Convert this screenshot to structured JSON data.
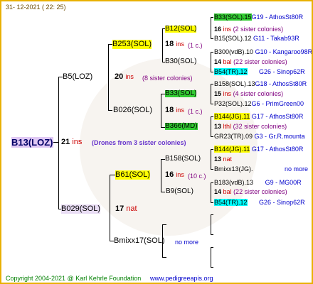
{
  "header": {
    "date": "31- 12-2021 ( 22: 25)"
  },
  "root": {
    "label": "B13(LOZ)",
    "count": "21",
    "count_suffix": "ins",
    "note": "(Drones from 3 sister colonies)"
  },
  "g1": [
    {
      "label": "B5(LOZ)",
      "count": "20",
      "count_suffix": "ins",
      "note": "(8 sister colonies)"
    },
    {
      "label": "B029(SOL)",
      "count": "17",
      "count_suffix": "nat"
    }
  ],
  "g2": [
    {
      "label": "B253(SOL)",
      "count": "18",
      "count_suffix": "ins",
      "note": "(1 c.)"
    },
    {
      "label": "B026(SOL)",
      "count": "18",
      "count_suffix": "ins",
      "note": "(1 c.)"
    },
    {
      "label": "B61(SOL)",
      "count": "16",
      "count_suffix": "ins",
      "note": "(10 c.)"
    },
    {
      "label": "Bmixx17(SOL)",
      "note": "no more"
    }
  ],
  "g3": [
    {
      "label": "B12(SOL)",
      "count": "16",
      "count_suffix": "ins",
      "note": "(2 sister colonies)"
    },
    {
      "label": "B30(SOL)",
      "count": "14",
      "count_suffix": "bal",
      "note": "(22 sister colonies)"
    },
    {
      "label": "B33(SOL)",
      "count": "15",
      "count_suffix": "ins",
      "note": "(4 sister colonies)"
    },
    {
      "label": "B366(MD)",
      "count": "13",
      "count_suffix": "lthl",
      "note": "(32 sister colonies)"
    },
    {
      "label": "B158(SOL)",
      "count": "13",
      "count_suffix": "nat"
    },
    {
      "label": "B9(SOL)",
      "count": "14",
      "count_suffix": "bal",
      "note": "(22 sister colonies)"
    }
  ],
  "g4": [
    {
      "code": "B33(SOL).15",
      "tail": "G19 - AthosSt80R"
    },
    {
      "code": "B15(SOL).12",
      "tail": "G11 - Takab93R"
    },
    {
      "code": "B300(vdB).10",
      "tail": "G10 - Kangaroo98R"
    },
    {
      "code": "B54(TR).12",
      "tail": "G26 - Sinop62R"
    },
    {
      "code": "B158(SOL).13",
      "tail": "G18 - AthosSt80R"
    },
    {
      "code": "P32(SOL).12",
      "tail": "G6 - PrimGreen00"
    },
    {
      "code": "B144(JG).11",
      "tail": "G17 - AthosSt80R"
    },
    {
      "code": "GR23(TR).09",
      "tail": "G3 - Gr.R.mounta"
    },
    {
      "code": "B144(JG).11",
      "tail": "G17 - AthosSt80R"
    },
    {
      "code": "Bmixx13(JG).",
      "tail": "no more"
    },
    {
      "code": "B183(vdB).13",
      "tail": "G9 - MG00R"
    },
    {
      "code": "B54(TR).12",
      "tail": "G26 - Sinop62R"
    }
  ],
  "footer": {
    "copyright": "Copyright 2004-2021 @ Karl Kehrle Foundation",
    "site": "www.pedigreeapis.org"
  }
}
